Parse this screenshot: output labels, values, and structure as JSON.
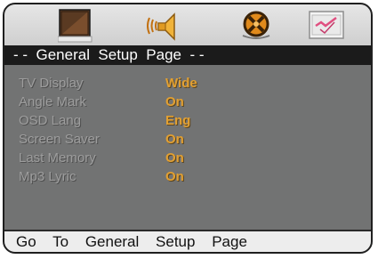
{
  "tabs": [
    {
      "icon": "general-setup-icon"
    },
    {
      "icon": "audio-speaker-icon"
    },
    {
      "icon": "video-reel-icon"
    },
    {
      "icon": "preference-checklist-icon"
    }
  ],
  "header": {
    "title": "- -  General  Setup  Page  - -"
  },
  "settings": [
    {
      "label": "TV Display",
      "value": "Wide"
    },
    {
      "label": "Angle Mark",
      "value": "On"
    },
    {
      "label": "OSD Lang",
      "value": "Eng"
    },
    {
      "label": "Screen Saver",
      "value": "On"
    },
    {
      "label": "Last Memory",
      "value": "On"
    },
    {
      "label": "Mp3 Lyric",
      "value": "On"
    }
  ],
  "status": {
    "words": [
      "Go",
      "To",
      "General",
      "Setup",
      "Page"
    ]
  },
  "colors": {
    "label": "#9d9d9d",
    "value": "#e2a032",
    "title_bg": "#1b1b1b",
    "panel_bg": "#727373",
    "tabbar_bg": "#d9d9d9",
    "status_bg": "#ededed"
  }
}
